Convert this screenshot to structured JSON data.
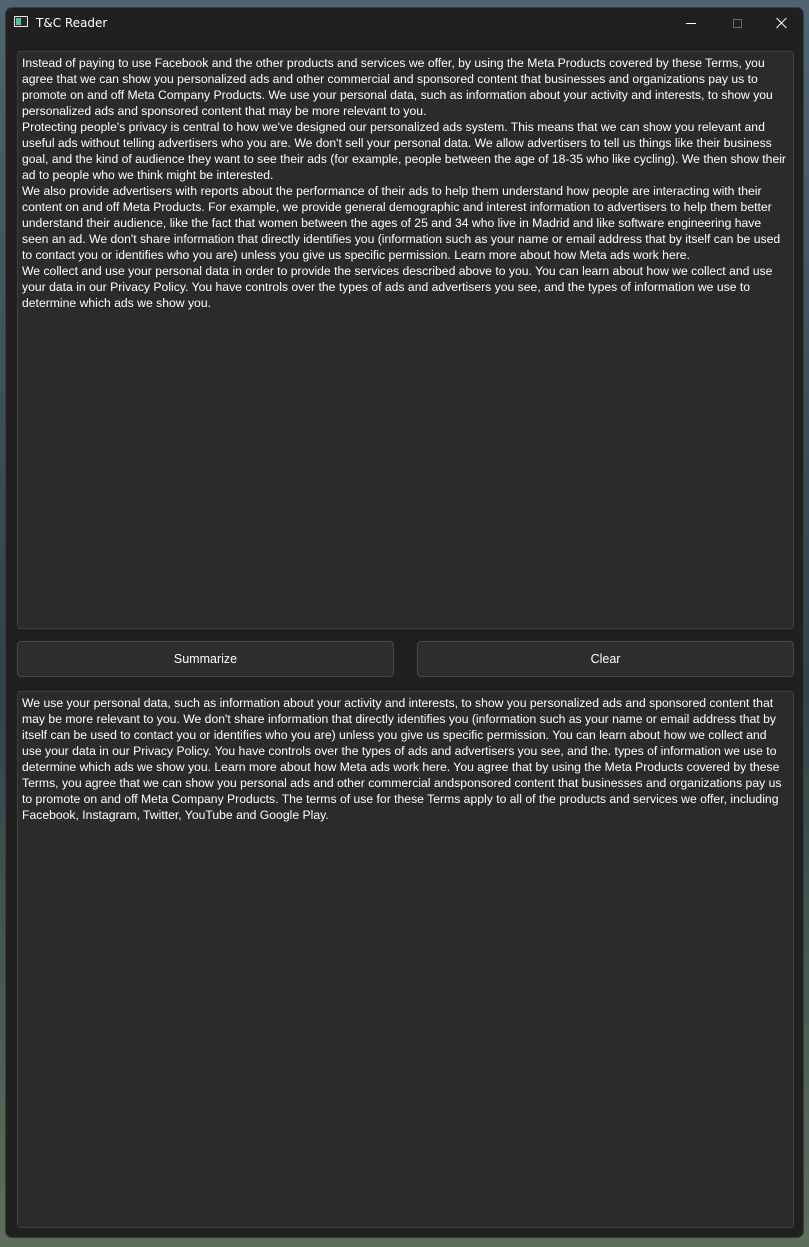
{
  "window": {
    "title": "T&C Reader"
  },
  "input": {
    "text": "Instead of paying to use Facebook and the other products and services we offer, by using the Meta Products covered by these Terms, you agree that we can show you personalized ads and other commercial and sponsored content that businesses and organizations pay us to promote on and off Meta Company Products. We use your personal data, such as information about your activity and interests, to show you personalized ads and sponsored content that may be more relevant to you.\nProtecting people's privacy is central to how we've designed our personalized ads system. This means that we can show you relevant and useful ads without telling advertisers who you are. We don't sell your personal data. We allow advertisers to tell us things like their business goal, and the kind of audience they want to see their ads (for example, people between the age of 18-35 who like cycling). We then show their ad to people who we think might be interested.\nWe also provide advertisers with reports about the performance of their ads to help them understand how people are interacting with their content on and off Meta Products. For example, we provide general demographic and interest information to advertisers to help them better understand their audience, like the fact that women between the ages of 25 and 34 who live in Madrid and like software engineering have seen an ad. We don't share information that directly identifies you (information such as your name or email address that by itself can be used to contact you or identifies who you are) unless you give us specific permission. Learn more about how Meta ads work here.\nWe collect and use your personal data in order to provide the services described above to you. You can learn about how we collect and use your data in our Privacy Policy. You have controls over the types of ads and advertisers you see, and the types of information we use to determine which ads we show you."
  },
  "buttons": {
    "summarize": "Summarize",
    "clear": "Clear"
  },
  "output": {
    "text": "We use your personal data, such as information about your activity and interests, to show you personalized ads and sponsored content that may be more relevant to you. We don't share information that directly identifies you (information such as your name or email address that by itself can be used to contact you or identifies who you are) unless you give us specific permission. You can learn about how we collect and use your data in our Privacy Policy. You have controls over the types of ads and advertisers you see, and the. types of information we use to determine which ads we show you. Learn more about how Meta ads work here. You agree that by using the Meta Products covered by these Terms, you agree that we can show you personal ads and other commercial andsponsored content that businesses and organizations pay us to promote on and off Meta Company Products. The terms of use for these Terms apply to all of the products and services we offer, including Facebook, Instagram, Twitter, YouTube and Google Play."
  }
}
